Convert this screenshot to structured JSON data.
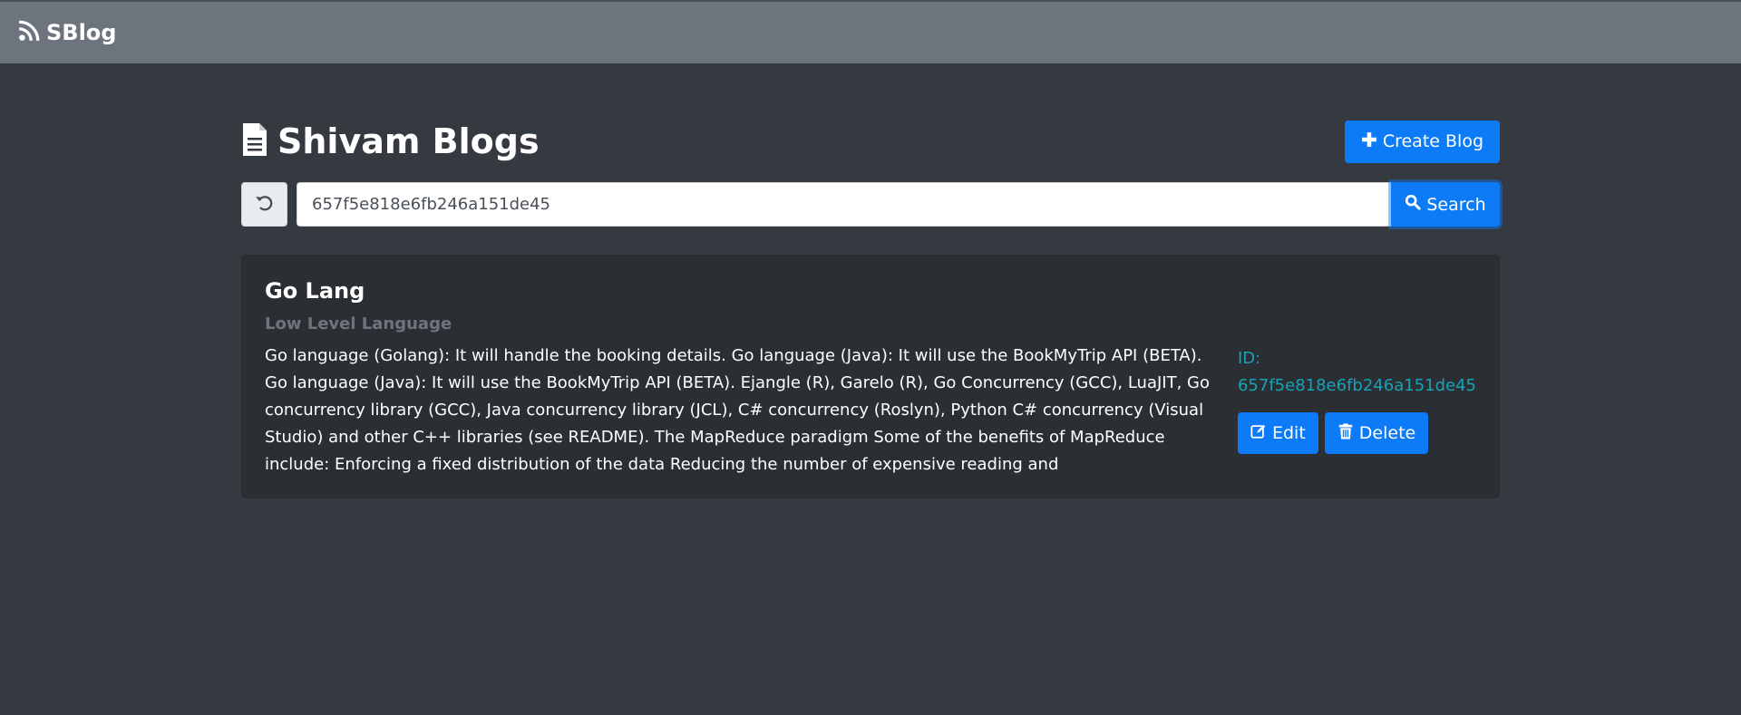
{
  "navbar": {
    "brand": "SBlog",
    "brand_icon": "blogger-icon"
  },
  "header": {
    "title": "Shivam Blogs",
    "title_icon": "document-icon",
    "create_button": "Create Blog"
  },
  "search": {
    "reset_icon": "undo-icon",
    "value": "657f5e818e6fb246a151de45",
    "button": "Search"
  },
  "blog": {
    "title": "Go Lang",
    "subtitle": "Low Level Language",
    "body": "Go language (Golang): It will handle the booking details. Go language (Java): It will use the BookMyTrip API (BETA). Go language (Java): It will use the BookMyTrip API (BETA). Ejangle (R), Garelo (R), Go Concurrency (GCC), LuaJIT, Go concurrency library (GCC), Java concurrency library (JCL), C# concurrency (Roslyn), Python C# concurrency (Visual Studio) and other C++ libraries (see README). The MapReduce paradigm Some of the benefits of MapReduce include: Enforcing a fixed distribution of the data Reducing the number of expensive reading and",
    "id_label": "ID:",
    "id_value": "657f5e818e6fb246a151de45",
    "edit_button": "Edit",
    "delete_button": "Delete"
  },
  "colors": {
    "navbar": "#6c757d",
    "background": "#343a40",
    "card": "#2b2f33",
    "primary": "#0d7bf7",
    "info": "#17a2b8",
    "muted": "#6c757d"
  }
}
